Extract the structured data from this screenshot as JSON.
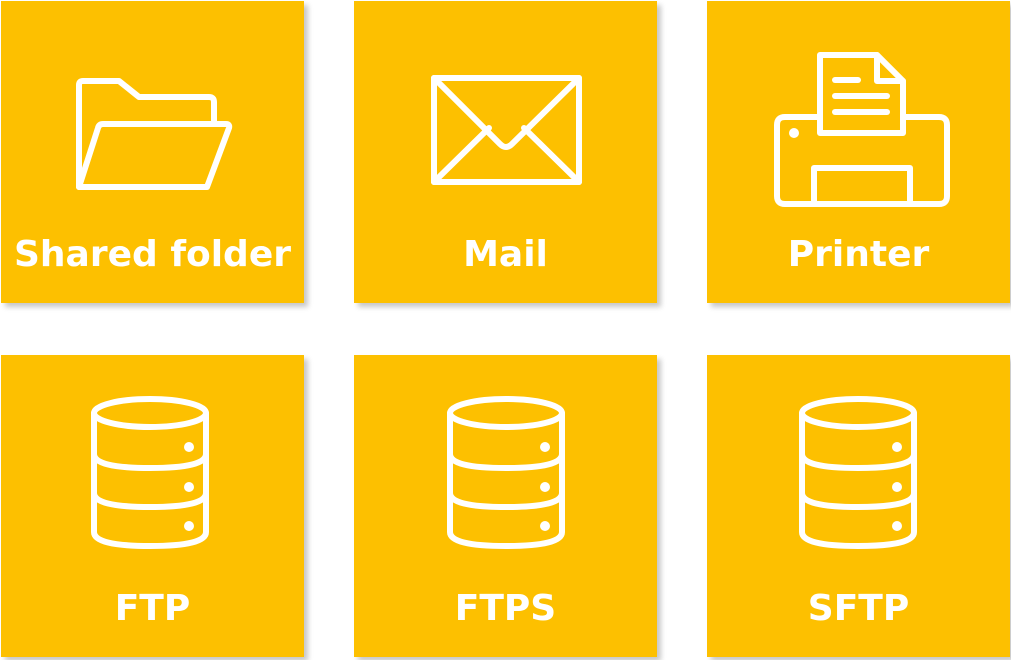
{
  "colors": {
    "tile_background": "#FDC000",
    "icon_and_text": "#FFFFFF"
  },
  "tiles": [
    {
      "label": "Shared folder",
      "icon": "folder-icon"
    },
    {
      "label": "Mail",
      "icon": "envelope-icon"
    },
    {
      "label": "Printer",
      "icon": "printer-icon"
    },
    {
      "label": "FTP",
      "icon": "database-icon"
    },
    {
      "label": "FTPS",
      "icon": "database-icon"
    },
    {
      "label": "SFTP",
      "icon": "database-icon"
    }
  ]
}
